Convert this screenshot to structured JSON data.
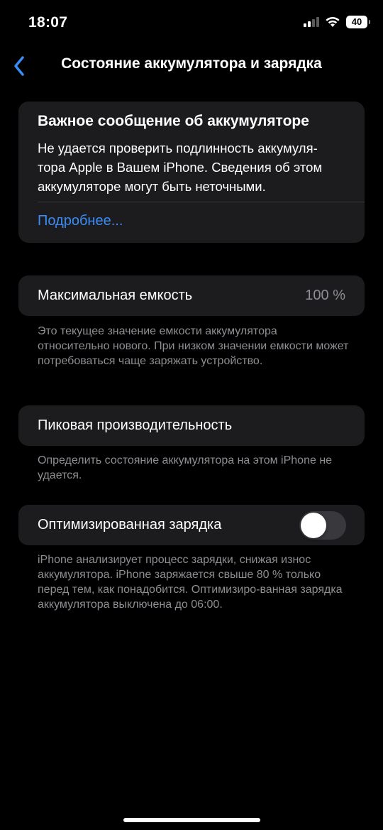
{
  "status_bar": {
    "time": "18:07",
    "battery_level": "40",
    "icons": [
      "signal-icon",
      "wifi-icon",
      "battery-icon"
    ]
  },
  "nav": {
    "back_icon": "chevron-left-icon",
    "title": "Состояние аккумулятора и зарядка"
  },
  "alert": {
    "title": "Важное сообщение об аккумуляторе",
    "body": "Не удается проверить подлинность аккумуля-тора Apple в Вашем iPhone. Сведения об этом аккумуляторе могут быть неточными.",
    "body_line1": "Не удается проверить подлинность аккумуля-",
    "body_line2": "тора Apple в Вашем iPhone. Сведения об этом",
    "body_line3": "аккумуляторе могут быть неточными.",
    "link": "Подробнее..."
  },
  "capacity": {
    "label": "Максимальная емкость",
    "value": "100 %",
    "footnote": "Это текущее значение емкости аккумулятора относительно нового. При низком значении емкости может потребоваться чаще заряжать устройство."
  },
  "peak": {
    "label": "Пиковая производительность",
    "footnote": "Определить состояние аккумулятора на этом iPhone не удается."
  },
  "optimized": {
    "label": "Оптимизированная зарядка",
    "toggle_on": false,
    "footnote": "iPhone анализирует процесс зарядки, снижая износ аккумулятора. iPhone заряжается свыше 80 % только перед тем, как понадобится. Оптимизиро-ванная зарядка аккумулятора выключена до 06:00."
  },
  "colors": {
    "background": "#000000",
    "card": "#1c1c1e",
    "link": "#3a8cf7",
    "secondary_text": "#8e8e93",
    "toggle_off": "#39393d"
  }
}
